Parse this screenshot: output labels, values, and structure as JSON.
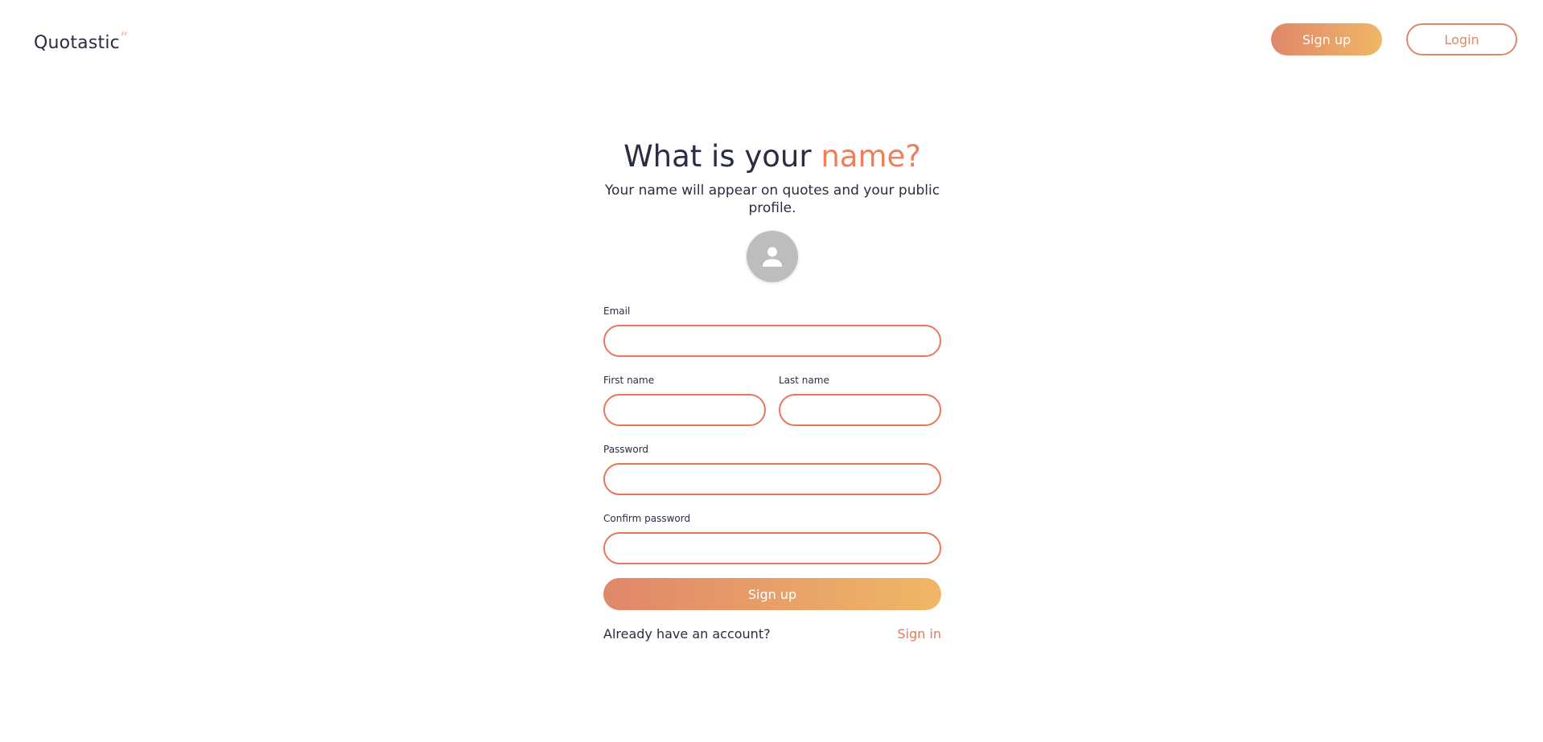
{
  "header": {
    "logo_text": "Quotastic",
    "logo_mark": "”",
    "signup_label": "Sign up",
    "login_label": "Login"
  },
  "main": {
    "title_part1": "What is your ",
    "title_accent": "name?",
    "subtitle": "Your name will appear on quotes and your public profile.",
    "avatar_icon": "user-icon"
  },
  "form": {
    "email_label": "Email",
    "email_value": "",
    "first_name_label": "First name",
    "first_name_value": "",
    "last_name_label": "Last name",
    "last_name_value": "",
    "password_label": "Password",
    "password_value": "",
    "confirm_password_label": "Confirm password",
    "confirm_password_value": "",
    "submit_label": "Sign up",
    "have_account_text": "Already have an account?",
    "signin_label": "Sign in"
  },
  "colors": {
    "accent": "#e8775a",
    "gradient_start": "#e0876a",
    "gradient_end": "#f0b766",
    "text_dark": "#2b2d42",
    "avatar_bg": "#bdbdbd"
  }
}
